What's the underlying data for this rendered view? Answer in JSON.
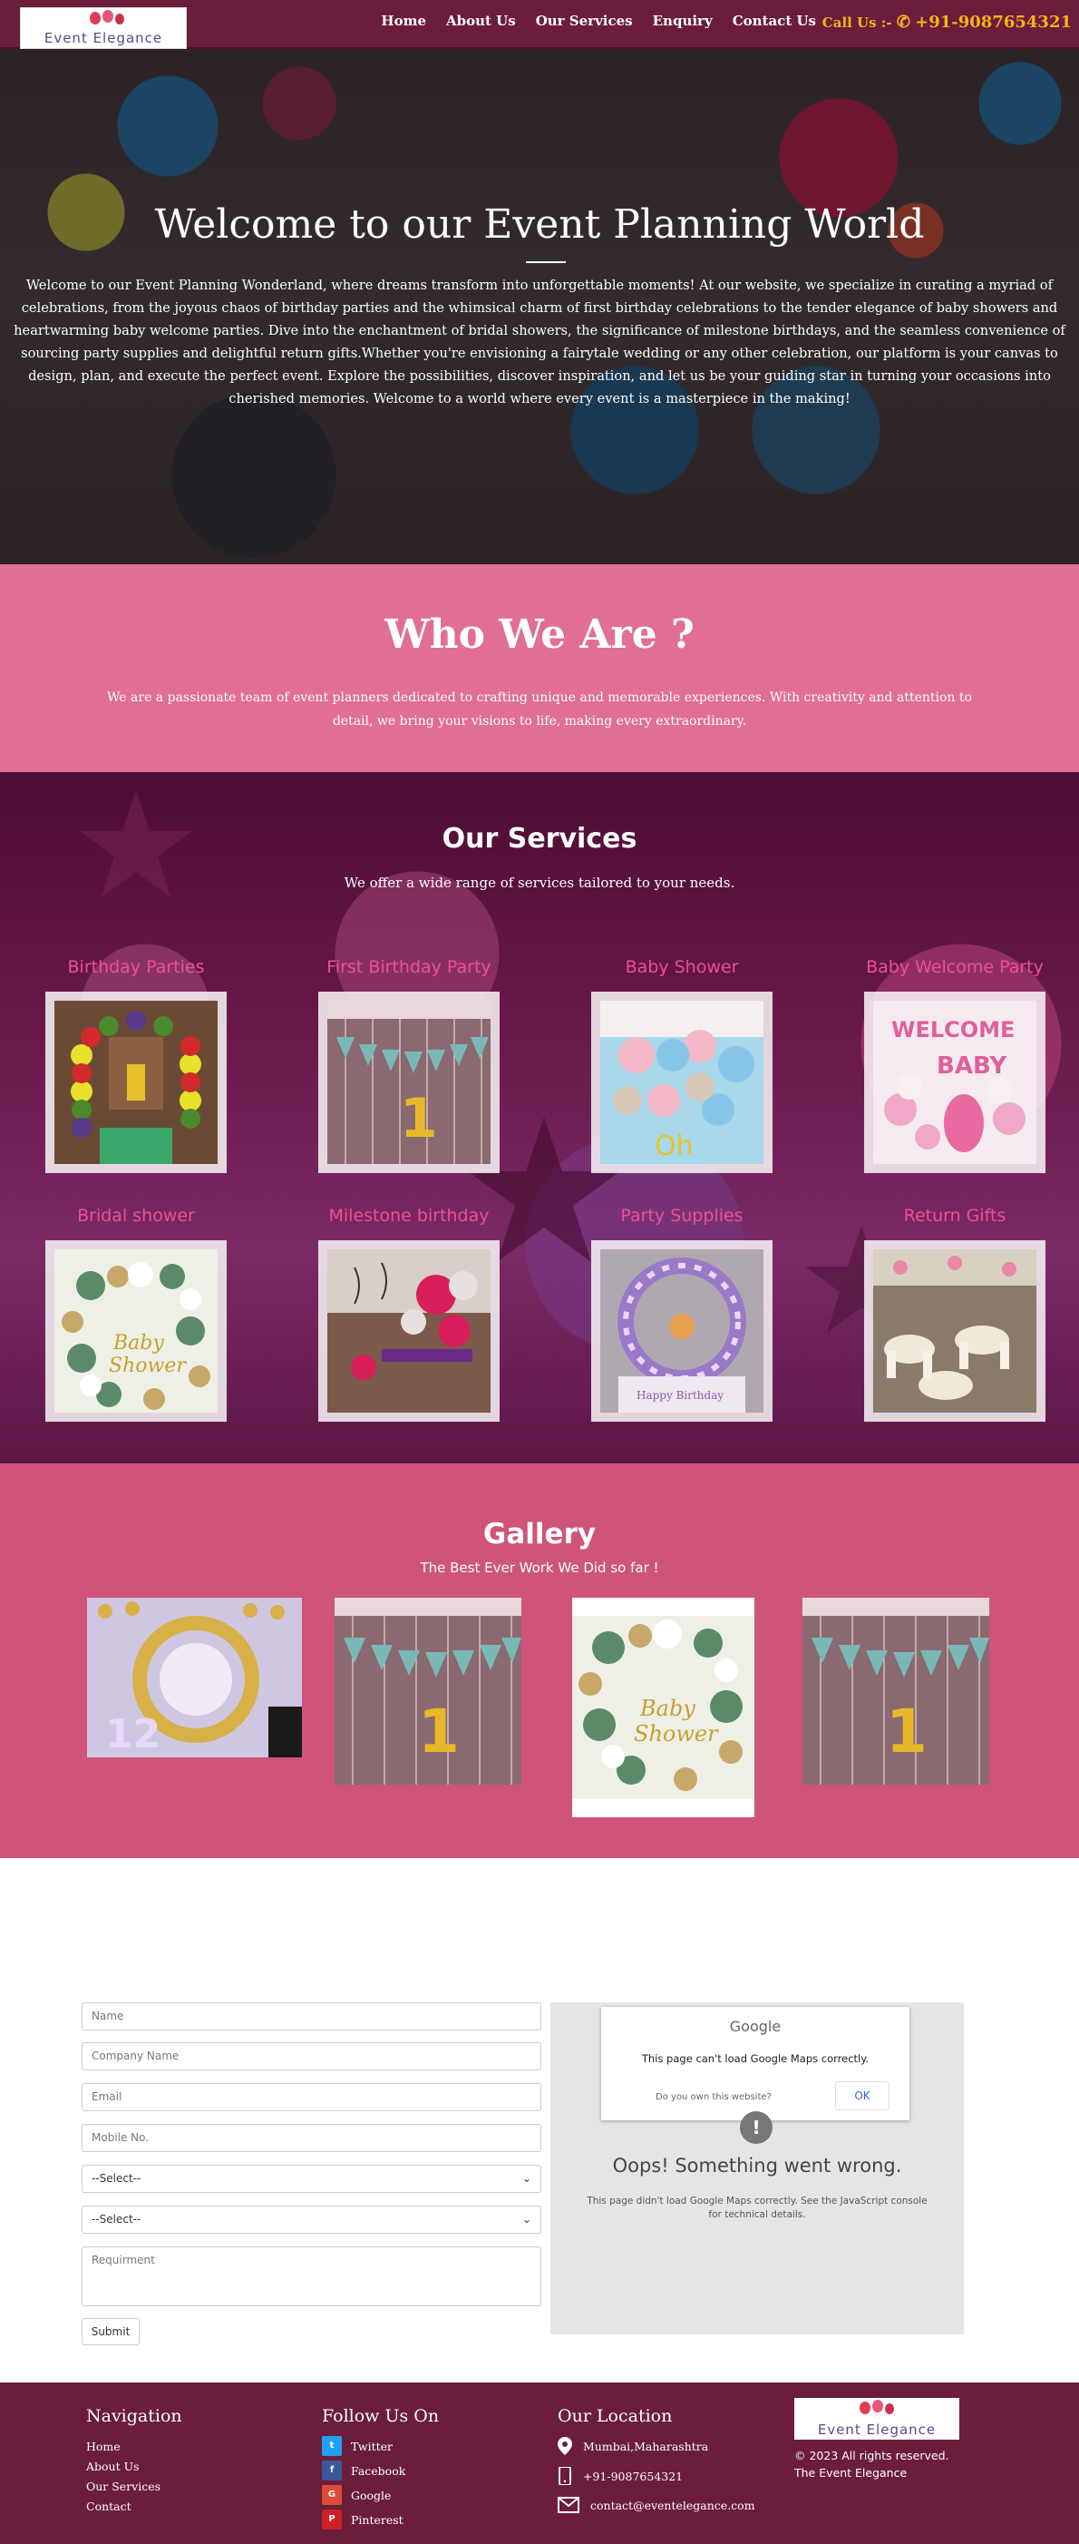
{
  "header": {
    "logo_text": "Event Elegance",
    "nav": [
      "Home",
      "About Us",
      "Our Services",
      "Enquiry",
      "Contact Us"
    ],
    "call_label": "Call Us :-",
    "phone": "+91-9087654321"
  },
  "hero": {
    "title": "Welcome to our Event Planning World",
    "text": "Welcome to our Event Planning Wonderland, where dreams transform into unforgettable moments! At our website, we specialize in curating a myriad of celebrations, from the joyous chaos of birthday parties and the whimsical charm of first birthday celebrations to the tender elegance of baby showers and heartwarming baby welcome parties. Dive into the enchantment of bridal showers, the significance of milestone birthdays, and the seamless convenience of sourcing party supplies and delightful return gifts.Whether you're envisioning a fairytale wedding or any other celebration, our platform is your canvas to design, plan, and execute the perfect event. Explore the possibilities, discover inspiration, and let us be your guiding star in turning your occasions into cherished memories. Welcome to a world where every event is a masterpiece in the making!"
  },
  "who": {
    "title": "Who We Are ?",
    "text": "We are a passionate team of event planners dedicated to crafting unique and memorable experiences. With creativity and attention to detail, we bring your visions to life, making every extraordinary."
  },
  "services": {
    "title": "Our Services",
    "subtitle": "We offer a wide range of services tailored to your needs.",
    "items": [
      {
        "label": "Birthday Parties"
      },
      {
        "label": "First Birthday Party"
      },
      {
        "label": "Baby Shower"
      },
      {
        "label": "Baby Welcome Party"
      },
      {
        "label": "Bridal shower"
      },
      {
        "label": "Milestone birthday"
      },
      {
        "label": "Party Supplies"
      },
      {
        "label": "Return Gifts"
      }
    ]
  },
  "gallery": {
    "title": "Gallery",
    "subtitle": "The Best Ever Work We Did so far !"
  },
  "form": {
    "name_placeholder": "Name",
    "company_placeholder": "Company Name",
    "email_placeholder": "Email",
    "mobile_placeholder": "Mobile No.",
    "select1": "--Select--",
    "select2": "--Select--",
    "requirement_placeholder": "Requirment",
    "submit_label": "Submit"
  },
  "map": {
    "logo": "Google",
    "message": "This page can't load Google Maps correctly.",
    "own_question": "Do you own this website?",
    "ok_label": "OK",
    "oops": "Oops! Something went wrong.",
    "detail": "This page didn't load Google Maps correctly. See the JavaScript console for technical details."
  },
  "footer": {
    "nav_heading": "Navigation",
    "nav_links": [
      "Home",
      "About Us",
      "Our Services",
      "Contact"
    ],
    "follow_heading": "Follow Us On",
    "social": [
      {
        "label": "Twitter",
        "color": "#1da1f2",
        "icon": "twitter-icon"
      },
      {
        "label": "Facebook",
        "color": "#3b5998",
        "icon": "facebook-icon"
      },
      {
        "label": "Google",
        "color": "#dd4b39",
        "icon": "google-icon"
      },
      {
        "label": "Pinterest",
        "color": "#cb2027",
        "icon": "pinterest-icon"
      }
    ],
    "location_heading": "Our Location",
    "address": "Mumbai,Maharashtra",
    "phone": "+91-9087654321",
    "email": "contact@eventelegance.com",
    "copyright": "© 2023 All rights reserved.",
    "brand": "The Event Elegance"
  },
  "colors": {
    "nav_bg": "#6b1d3b",
    "who_bg": "#e06f93",
    "gallery_bg": "#ce5579",
    "accent_gold": "#f5b41a",
    "service_title": "#ee4f92"
  }
}
